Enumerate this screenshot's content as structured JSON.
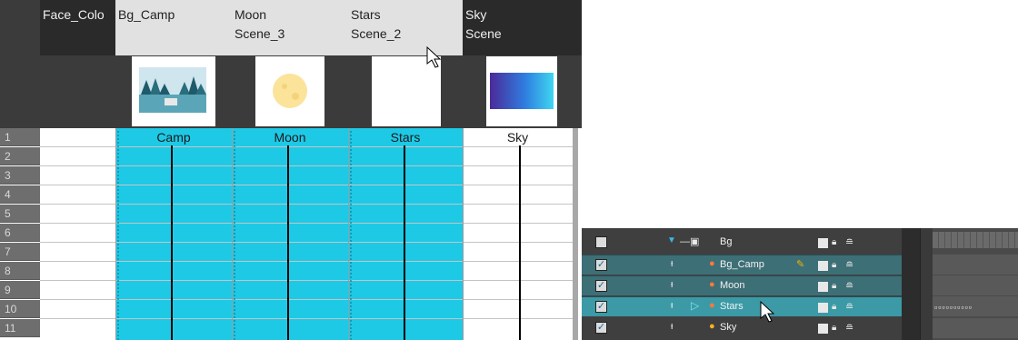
{
  "xsheet": {
    "columns": [
      {
        "name": "Face_Colo",
        "sub": ""
      },
      {
        "name": "Bg_Camp",
        "sub": ""
      },
      {
        "name": "Moon",
        "sub": "Scene_3"
      },
      {
        "name": "Stars",
        "sub": "Scene_2"
      },
      {
        "name": "Sky",
        "sub": "Scene"
      }
    ],
    "frames": [
      "1",
      "2",
      "3",
      "4",
      "5",
      "6",
      "7",
      "8",
      "9",
      "10",
      "11"
    ],
    "cells": {
      "bg_camp": "Camp",
      "moon": "Moon",
      "stars": "Stars",
      "sky": "Sky"
    }
  },
  "timeline": {
    "rows": [
      {
        "name": "Bg",
        "checked": false
      },
      {
        "name": "Bg_Camp",
        "checked": true
      },
      {
        "name": "Moon",
        "checked": true
      },
      {
        "name": "Stars",
        "checked": true
      },
      {
        "name": "Sky",
        "checked": true
      }
    ],
    "check_glyph": "✓"
  },
  "icons": [
    "group-icon",
    "peg-icon",
    "drawing-layer-icon",
    "pencil-icon",
    "lock-icon",
    "layers-icon",
    "mouse-cursor-icon"
  ],
  "colors": {
    "cell_cyan": "#1ec9e6",
    "selected_row": "#3b9aa6",
    "layer_row": "#3d6f76",
    "header_dark": "#2a2a2a"
  }
}
